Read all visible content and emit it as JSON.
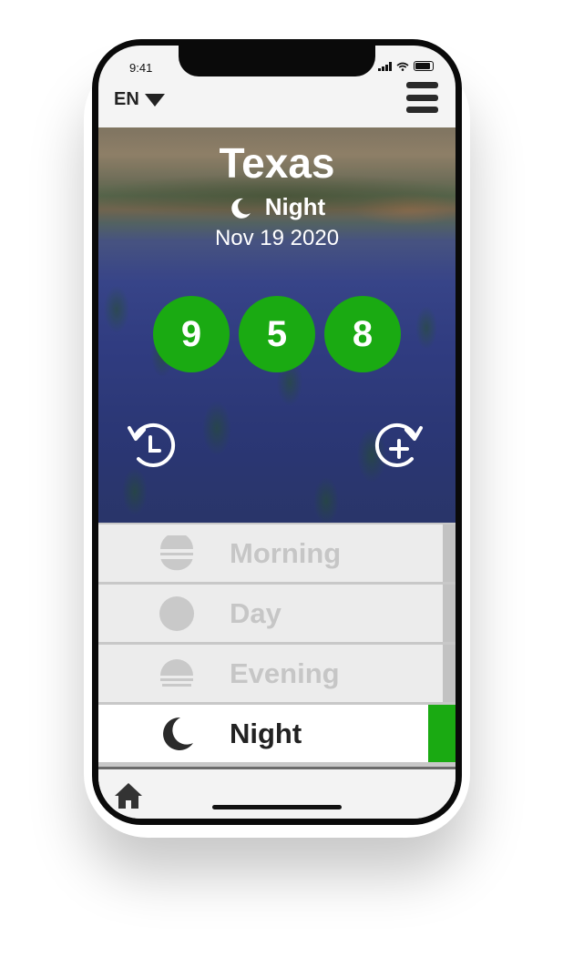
{
  "status_bar": {
    "time": "9:41"
  },
  "header": {
    "language": "EN"
  },
  "hero": {
    "city": "Texas",
    "period": "Night",
    "date": "Nov 19 2020",
    "numbers": [
      "9",
      "5",
      "8"
    ]
  },
  "periods": [
    {
      "label": "Morning",
      "icon": "sunrise-icon",
      "active": false
    },
    {
      "label": "Day",
      "icon": "sun-icon",
      "active": false
    },
    {
      "label": "Evening",
      "icon": "sunset-icon",
      "active": false
    },
    {
      "label": "Night",
      "icon": "moon-icon",
      "active": true
    }
  ],
  "colors": {
    "accent": "#1aaa12",
    "inactive_text": "#c6c6c6",
    "active_text": "#222222"
  }
}
